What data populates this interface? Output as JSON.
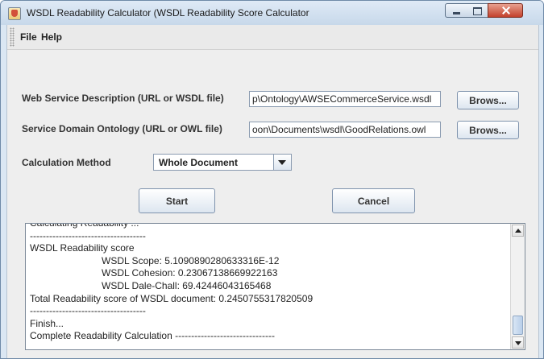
{
  "window": {
    "title": "WSDL Readability Calculator (WSDL Readability Score Calculator"
  },
  "menu": {
    "items": [
      "File",
      "Help"
    ]
  },
  "form": {
    "wsdl_label": "Web Service Description (URL or WSDL file)",
    "wsdl_value": "p\\Ontology\\AWSECommerceService.wsdl",
    "wsdl_browse": "Brows...",
    "owl_label": "Service Domain Ontology (URL or OWL file)",
    "owl_value": "oon\\Documents\\wsdl\\GoodRelations.owl",
    "owl_browse": "Brows...",
    "method_label": "Calculation Method",
    "method_selected": "Whole Document"
  },
  "actions": {
    "start": "Start",
    "cancel": "Cancel"
  },
  "output": {
    "lines": [
      "Calculating Readability ...",
      "------------------------------------",
      "WSDL Readability score",
      "WSDL Scope: 5.1090890280633316E-12",
      "WSDL Cohesion: 0.23067138669922163",
      "WSDL Dale-Chall: 69.42446043165468",
      "Total Readability score of WSDL document: 0.2450755317820509",
      "------------------------------------",
      "Finish...",
      "Complete Readability Calculation -------------------------------"
    ]
  },
  "icons": {
    "app": "java-cup-icon",
    "minimize": "minimize-icon",
    "maximize": "maximize-icon",
    "close": "close-icon",
    "dropdown": "chevron-down-icon"
  }
}
